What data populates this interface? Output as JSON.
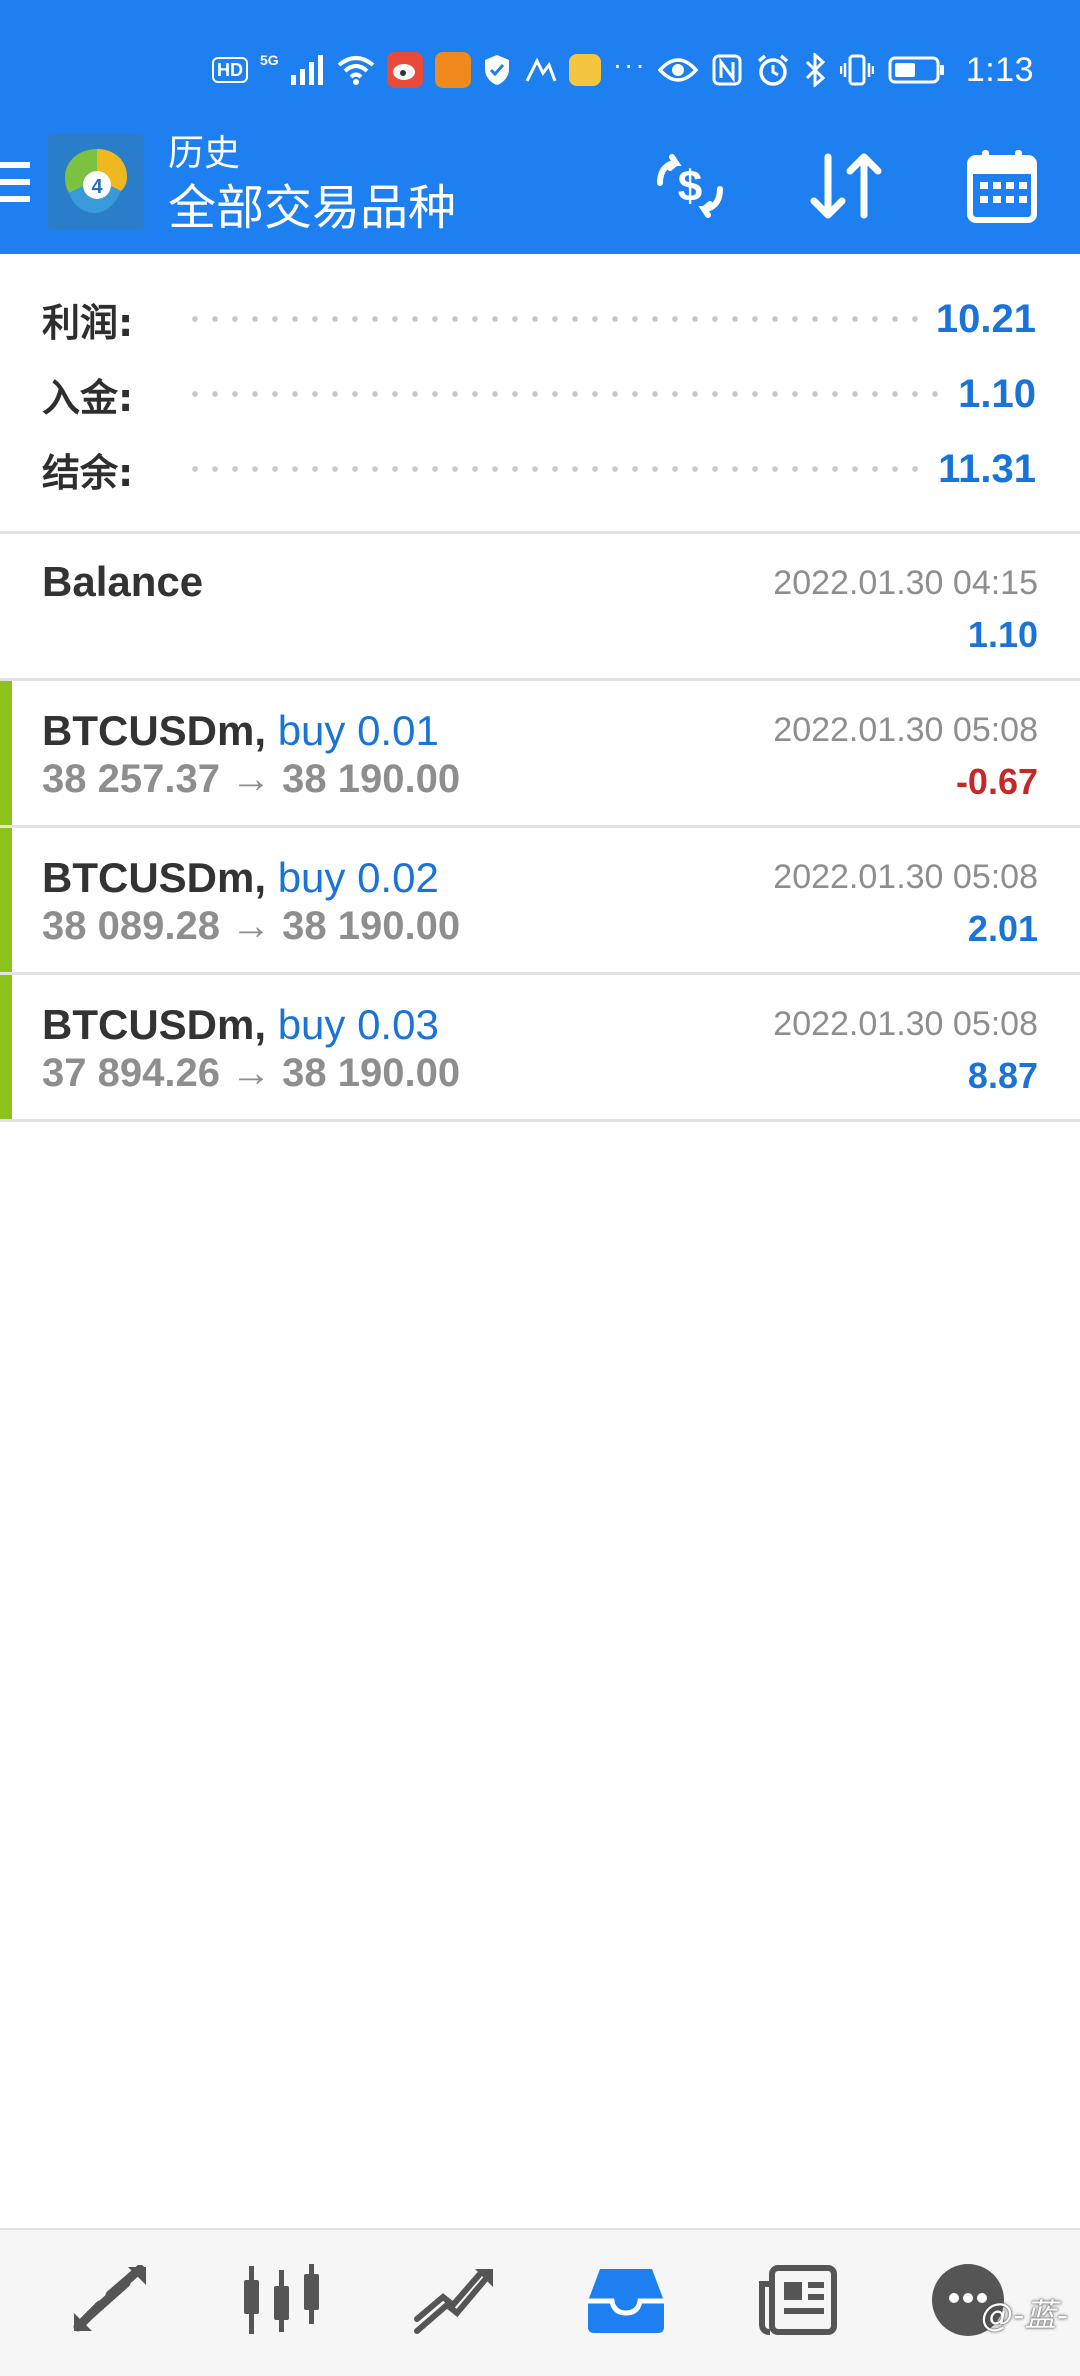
{
  "status_bar": {
    "hd": "HD",
    "network": "5G",
    "more": "···",
    "time": "1:13"
  },
  "app_bar": {
    "section": "历史",
    "title": "全部交易品种"
  },
  "summary": {
    "profit_label": "利润:",
    "profit_value": "10.21",
    "deposit_label": "入金:",
    "deposit_value": "1.10",
    "balance_label": "结余:",
    "balance_value": "11.31"
  },
  "history": {
    "balance": {
      "title": "Balance",
      "time": "2022.01.30 04:15",
      "amount": "1.10"
    },
    "deals": [
      {
        "symbol": "BTCUSDm,",
        "type": "buy 0.01",
        "prices": "38 257.37 → 38 190.00",
        "time": "2022.01.30 05:08",
        "profit": "-0.67"
      },
      {
        "symbol": "BTCUSDm,",
        "type": "buy 0.02",
        "prices": "38 089.28 → 38 190.00",
        "time": "2022.01.30 05:08",
        "profit": "2.01"
      },
      {
        "symbol": "BTCUSDm,",
        "type": "buy 0.03",
        "prices": "37 894.26 → 38 190.00",
        "time": "2022.01.30 05:08",
        "profit": "8.87"
      }
    ]
  },
  "bottom_nav": {
    "items": [
      "quotes-icon",
      "chart-icon",
      "trade-icon",
      "history-icon",
      "news-icon",
      "chat-icon"
    ],
    "active_index": 3
  },
  "watermark": "@-蓝-",
  "colors": {
    "header_bg": "#1e7ff0",
    "accent_blue": "#1a73d9",
    "loss_red": "#c62828",
    "buy_bar_green": "#8cc21a",
    "muted_gray": "#8e8e8e"
  }
}
